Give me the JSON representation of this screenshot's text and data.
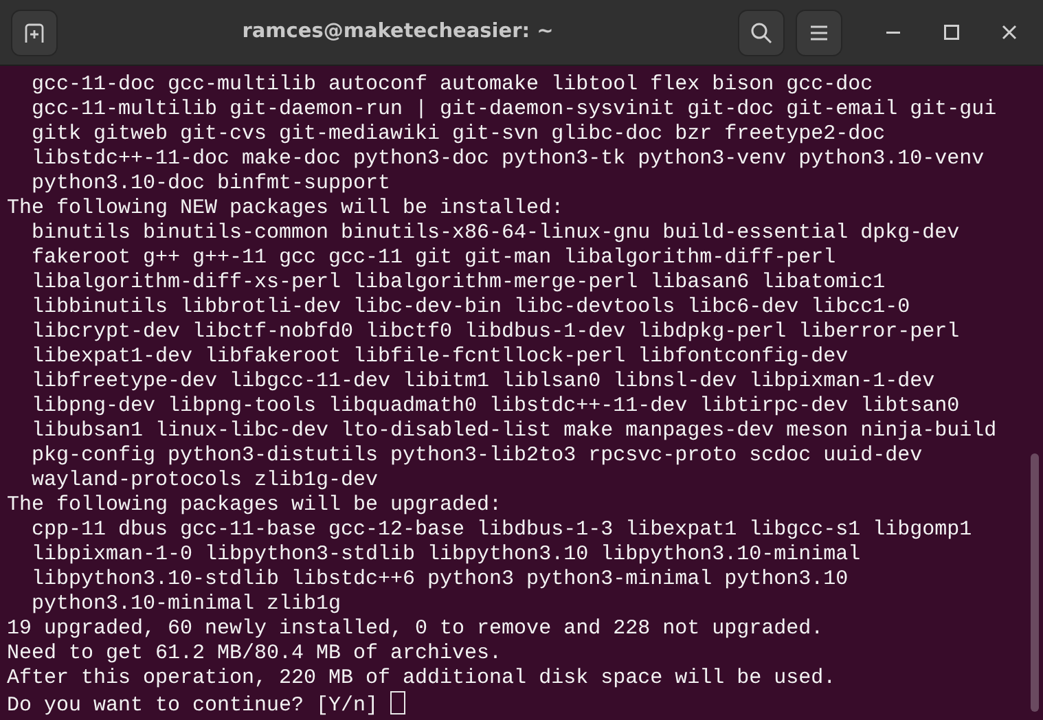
{
  "window": {
    "title": "ramces@maketecheasier: ~"
  },
  "terminal": {
    "lines": [
      "  gcc-11-doc gcc-multilib autoconf automake libtool flex bison gcc-doc",
      "  gcc-11-multilib git-daemon-run | git-daemon-sysvinit git-doc git-email git-gui",
      "  gitk gitweb git-cvs git-mediawiki git-svn glibc-doc bzr freetype2-doc",
      "  libstdc++-11-doc make-doc python3-doc python3-tk python3-venv python3.10-venv",
      "  python3.10-doc binfmt-support",
      "The following NEW packages will be installed:",
      "  binutils binutils-common binutils-x86-64-linux-gnu build-essential dpkg-dev",
      "  fakeroot g++ g++-11 gcc gcc-11 git git-man libalgorithm-diff-perl",
      "  libalgorithm-diff-xs-perl libalgorithm-merge-perl libasan6 libatomic1",
      "  libbinutils libbrotli-dev libc-dev-bin libc-devtools libc6-dev libcc1-0",
      "  libcrypt-dev libctf-nobfd0 libctf0 libdbus-1-dev libdpkg-perl liberror-perl",
      "  libexpat1-dev libfakeroot libfile-fcntllock-perl libfontconfig-dev",
      "  libfreetype-dev libgcc-11-dev libitm1 liblsan0 libnsl-dev libpixman-1-dev",
      "  libpng-dev libpng-tools libquadmath0 libstdc++-11-dev libtirpc-dev libtsan0",
      "  libubsan1 linux-libc-dev lto-disabled-list make manpages-dev meson ninja-build",
      "  pkg-config python3-distutils python3-lib2to3 rpcsvc-proto scdoc uuid-dev",
      "  wayland-protocols zlib1g-dev",
      "The following packages will be upgraded:",
      "  cpp-11 dbus gcc-11-base gcc-12-base libdbus-1-3 libexpat1 libgcc-s1 libgomp1",
      "  libpixman-1-0 libpython3-stdlib libpython3.10 libpython3.10-minimal",
      "  libpython3.10-stdlib libstdc++6 python3 python3-minimal python3.10",
      "  python3.10-minimal zlib1g",
      "19 upgraded, 60 newly installed, 0 to remove and 228 not upgraded.",
      "Need to get 61.2 MB/80.4 MB of archives.",
      "After this operation, 220 MB of additional disk space will be used.",
      "Do you want to continue? [Y/n] "
    ],
    "cursor_visible": true
  }
}
